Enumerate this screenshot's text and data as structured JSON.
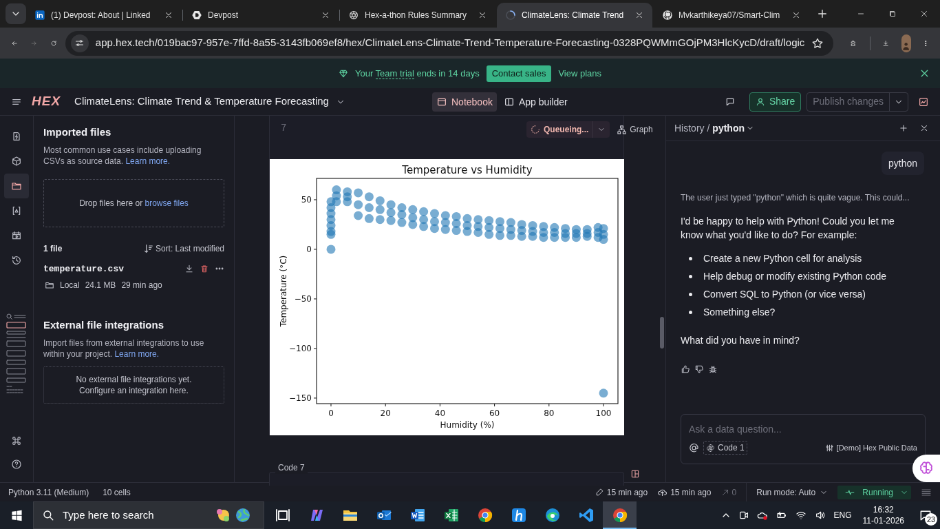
{
  "browser": {
    "tabs": [
      {
        "kind": "linkedin",
        "label": "(1) Devpost: About | Linked",
        "selected": false
      },
      {
        "kind": "devpost",
        "label": "Devpost",
        "selected": false
      },
      {
        "kind": "openai",
        "label": "Hex-a-thon Rules Summary",
        "selected": false
      },
      {
        "kind": "loading",
        "label": "ClimateLens: Climate Trend",
        "selected": true
      },
      {
        "kind": "github",
        "label": "Mvkarthikeya07/Smart-Clim",
        "selected": false
      }
    ],
    "address": "app.hex.tech/019bac97-957e-7ffd-8a55-3143fb069ef8/hex/ClimateLens-Climate-Trend-Temperature-Forecasting-0328PQWMmGOjPM3HlcKycD/draft/logic"
  },
  "banner": {
    "prefix": "Your",
    "link": "Team trial",
    "suffix": "ends in 14 days",
    "button": "Contact sales",
    "plans": "View plans"
  },
  "header": {
    "logo": "HEX",
    "title": "ClimateLens: Climate Trend & Temperature Forecasting",
    "views": [
      {
        "kind": "notebook",
        "label": "Notebook",
        "selected": true
      },
      {
        "kind": "app",
        "label": "App builder",
        "selected": false
      }
    ],
    "share": "Share",
    "publish": {
      "label": "Publish changes",
      "disabled": true
    }
  },
  "rail": {
    "items": [
      {
        "kind": "flash",
        "selected": false
      },
      {
        "kind": "cube",
        "selected": false
      },
      {
        "kind": "folder",
        "selected": true
      },
      {
        "kind": "variable",
        "selected": false
      },
      {
        "kind": "schedule",
        "selected": false
      },
      {
        "kind": "history",
        "selected": false
      }
    ]
  },
  "files_panel": {
    "heading": "Imported files",
    "description": "Most common use cases include uploading CSVs as source data.",
    "description_link": "Learn more.",
    "drop_text": "Drop files here or",
    "drop_link": "browse files",
    "count": "1 file",
    "sort": "Sort: Last modified",
    "files": [
      {
        "name": "temperature.csv",
        "location": "Local",
        "size": "24.1 MB",
        "modified": "29 min ago"
      }
    ],
    "external": {
      "heading": "External file integrations",
      "description": "Import files from external integrations to use within your project.",
      "link": "Learn more.",
      "empty_lines": [
        "No external file integrations yet.",
        "Configure an integration here."
      ]
    }
  },
  "notebook": {
    "line_number": "7",
    "run_status": "Queueing...",
    "graph": "Graph",
    "next_cell": "Code 7",
    "chart_data": {
      "type": "scatter",
      "title": "Temperature vs Humidity",
      "xlabel": "Humidity (%)",
      "ylabel": "Temperature (°C)",
      "xlim": [
        -5.3,
        105.3
      ],
      "ylim": [
        -155.6,
        71.5
      ],
      "xticks": [
        0,
        20,
        40,
        60,
        80,
        100
      ],
      "yticks": [
        {
          "value": -150,
          "label": "−150"
        },
        {
          "value": -100,
          "label": "−100"
        },
        {
          "value": -50,
          "label": "−50"
        },
        {
          "value": 0,
          "label": "0"
        },
        {
          "value": 50,
          "label": "50"
        }
      ],
      "x": [
        0,
        0,
        0,
        0,
        0,
        0,
        0,
        0,
        2,
        2,
        2,
        6,
        6,
        6,
        10,
        10,
        10,
        14,
        14,
        14,
        18,
        18,
        18,
        22,
        22,
        22,
        26,
        26,
        26,
        30,
        30,
        30,
        34,
        34,
        34,
        38,
        38,
        38,
        42,
        42,
        42,
        46,
        46,
        46,
        50,
        50,
        50,
        54,
        54,
        54,
        58,
        58,
        58,
        62,
        62,
        62,
        66,
        66,
        66,
        70,
        70,
        70,
        74,
        74,
        74,
        78,
        78,
        78,
        82,
        82,
        82,
        86,
        86,
        86,
        90,
        90,
        90,
        94,
        94,
        94,
        98,
        98,
        98,
        100,
        100,
        100,
        100
      ],
      "values": [
        48,
        42,
        36,
        30,
        24,
        18,
        15,
        0,
        60,
        54,
        48,
        58,
        53,
        48,
        57,
        45,
        34,
        53,
        42,
        31,
        49,
        40,
        30,
        45,
        37,
        29,
        42,
        35,
        27,
        40,
        32,
        25,
        38,
        30,
        23,
        36,
        28,
        21,
        34,
        27,
        20,
        33,
        26,
        19,
        31,
        24,
        18,
        30,
        23,
        17,
        29,
        22,
        15,
        28,
        21,
        14,
        27,
        20,
        14,
        25,
        19,
        13,
        24,
        18,
        13,
        23,
        17,
        12,
        22,
        17,
        12,
        21,
        16,
        12,
        20,
        16,
        12,
        20,
        16,
        13,
        22,
        17,
        12,
        21,
        15,
        10,
        -145
      ]
    }
  },
  "assistant": {
    "breadcrumb": "History /",
    "thread": "python",
    "user_message": "python",
    "thinking": "The user just typed \"python\" which is quite vague. This could...",
    "reply_intro": "I'd be happy to help with Python! Could you let me know what you'd like to do? For example:",
    "reply_items": [
      "Create a new Python cell for analysis",
      "Help debug or modify existing Python code",
      "Convert SQL to Python (or vice versa)",
      "Something else?"
    ],
    "reply_outro": "What did you have in mind?",
    "input": {
      "placeholder": "Ask a data question..."
    },
    "context_chip": "Code 1",
    "data_source": "[Demo] Hex Public Data"
  },
  "status_bar": {
    "kernel": "Python 3.11 (Medium)",
    "cells": "10 cells",
    "edited": "15 min ago",
    "published": "15 min ago",
    "shares": "0",
    "run_mode": "Run mode: Auto",
    "run_state": "Running"
  },
  "taskbar": {
    "search_placeholder": "Type here to search",
    "apps": [
      {
        "kind": "taskview",
        "selected": false
      },
      {
        "kind": "copilot",
        "selected": false
      },
      {
        "kind": "explorer",
        "selected": false
      },
      {
        "kind": "outlook",
        "selected": false
      },
      {
        "kind": "word",
        "selected": false
      },
      {
        "kind": "excel",
        "selected": false
      },
      {
        "kind": "chrome",
        "selected": false
      },
      {
        "kind": "hex",
        "selected": false
      },
      {
        "kind": "edge",
        "selected": false
      },
      {
        "kind": "vscode",
        "selected": false
      },
      {
        "kind": "chrome",
        "selected": true
      }
    ],
    "language": "ENG",
    "time": "16:32",
    "date": "11-01-2026",
    "notifications": "23"
  }
}
